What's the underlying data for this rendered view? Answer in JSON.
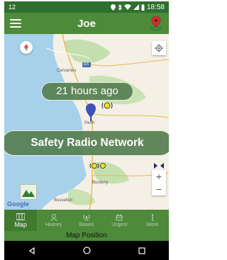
{
  "status_bar": {
    "left_icon": "12",
    "time": "18:58",
    "icons": [
      "location-icon",
      "bluetooth-icon",
      "wifi-icon",
      "signal-icon",
      "battery-icon"
    ]
  },
  "app_bar": {
    "title": "Joe",
    "menu_icon": "hamburger-icon",
    "right_icon": "map-pin-icon"
  },
  "map": {
    "labels": [
      "Cervantes",
      "Perth",
      "Bunbury",
      "Busselton"
    ],
    "road_label": "116",
    "last_seen": "21 hours ago",
    "network_name": "Safety Radio Network",
    "zoom_in": "+",
    "zoom_out": "−",
    "attribution": "Google"
  },
  "bottom_nav": {
    "items": [
      {
        "label": "Map",
        "icon": "map-icon",
        "active": true
      },
      {
        "label": "History",
        "icon": "person-icon",
        "active": false
      },
      {
        "label": "Bases",
        "icon": "radio-tower-icon",
        "active": false
      },
      {
        "label": "Urgent",
        "icon": "alert-icon",
        "active": false
      },
      {
        "label": "More",
        "icon": "more-icon",
        "active": false
      }
    ]
  },
  "footer": {
    "label": "Map Position"
  },
  "colors": {
    "primary": "#4d8a3a",
    "status": "#2f6f2f",
    "bubble": "#557e50",
    "pin_red": "#d32f2f",
    "marker_blue": "#3f51b5"
  }
}
